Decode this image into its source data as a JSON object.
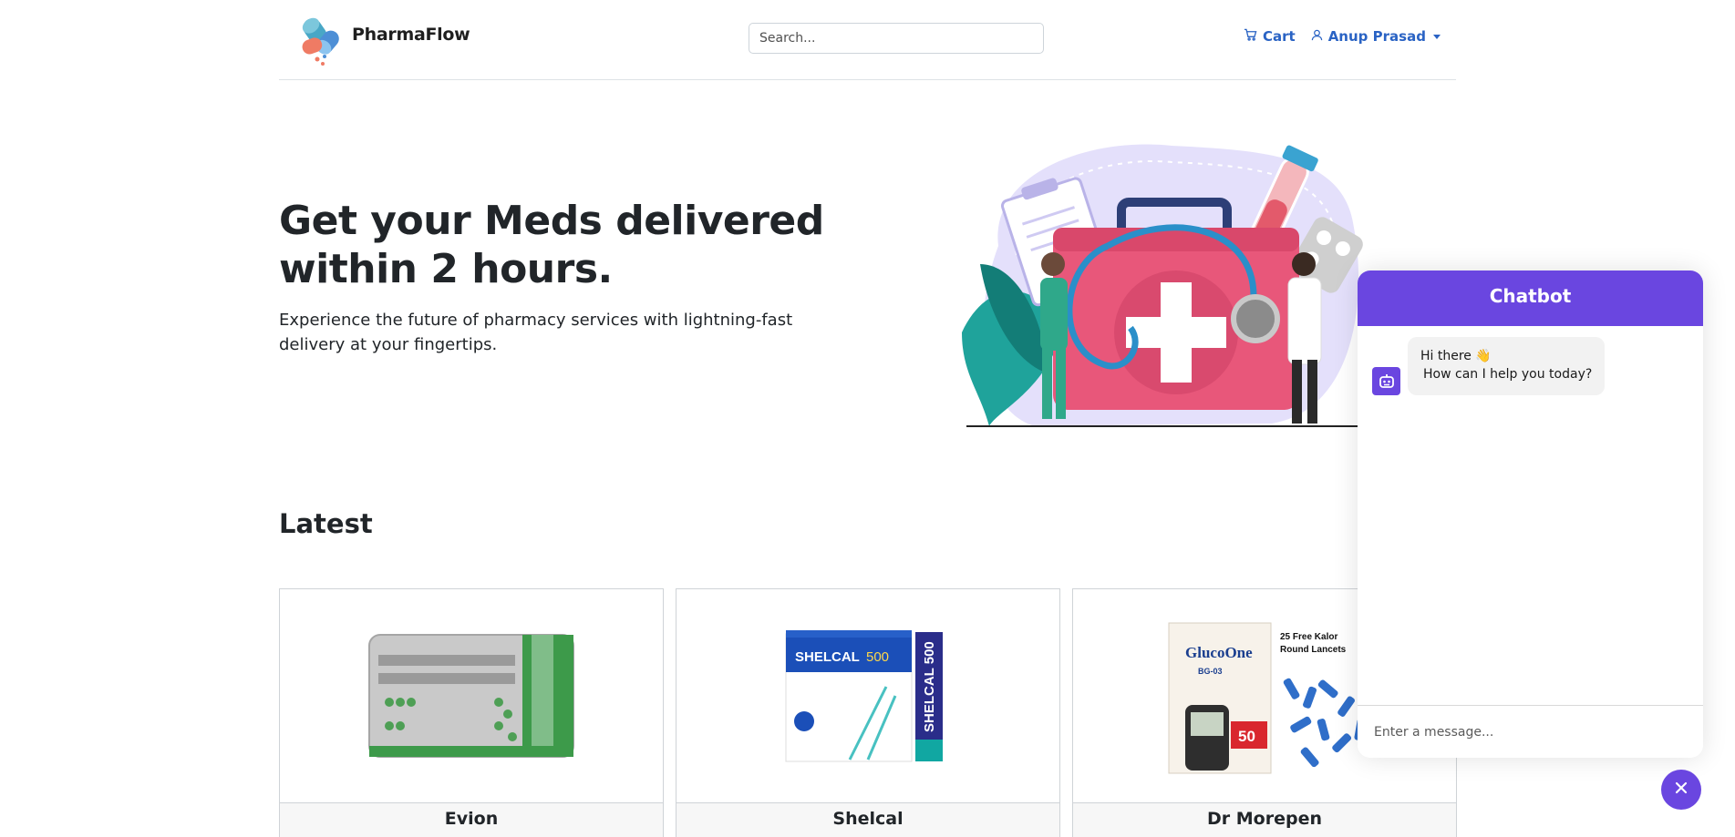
{
  "brand": {
    "name": "PharmaFlow",
    "logo_icon": "capsule-logo-icon"
  },
  "search": {
    "placeholder": "Search..."
  },
  "nav": {
    "cart_label": "Cart",
    "cart_icon": "cart-icon",
    "user_label": "Anup Prasad",
    "user_icon": "user-icon",
    "link_color": "#2a63c4"
  },
  "hero": {
    "title": "Get your Meds delivered within 2 hours.",
    "subtitle": "Experience the future of pharmacy services with lightning-fast delivery at your fingertips.",
    "illustration": "medical-kit-illustration"
  },
  "latest": {
    "heading": "Latest",
    "products": [
      {
        "name": "Evion",
        "image": "evion-blister-pack"
      },
      {
        "name": "Shelcal",
        "image": "shelcal-500-box"
      },
      {
        "name": "Dr Morepen",
        "image": "glucoone-test-strips-lancets"
      }
    ]
  },
  "chatbot": {
    "title": "Chatbot",
    "accent": "#6a46e0",
    "greeting_line1": "Hi there 👋",
    "greeting_line2": "How can I help you today?",
    "input_placeholder": "Enter a message...",
    "close_icon": "close-icon",
    "avatar_icon": "robot-icon"
  }
}
